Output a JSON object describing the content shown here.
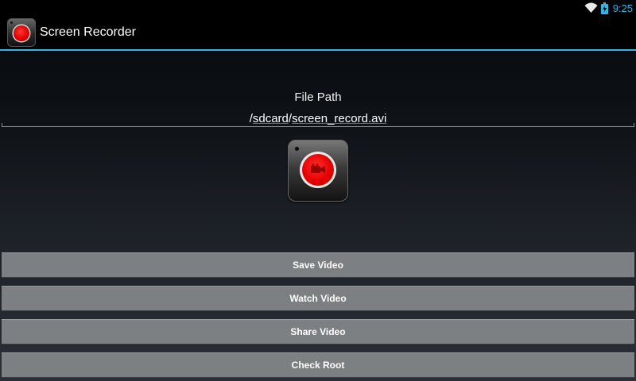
{
  "status_bar": {
    "time": "9:25",
    "icons": [
      "wifi-icon",
      "battery-charging-icon"
    ],
    "accent_color": "#33b5e5"
  },
  "action_bar": {
    "title": "Screen Recorder",
    "icon": "record-app-icon",
    "divider_color": "#33b5e5"
  },
  "file_path": {
    "label": "File Path",
    "value_prefix": "/",
    "value_part1": "sdcard",
    "value_sep": "/",
    "value_part2": "screen_record.avi"
  },
  "record_button": {
    "icon": "video-camera-icon",
    "color": "#e60000"
  },
  "buttons": {
    "save": "Save Video",
    "watch": "Watch Video",
    "share": "Share Video",
    "check_root": "Check Root"
  }
}
